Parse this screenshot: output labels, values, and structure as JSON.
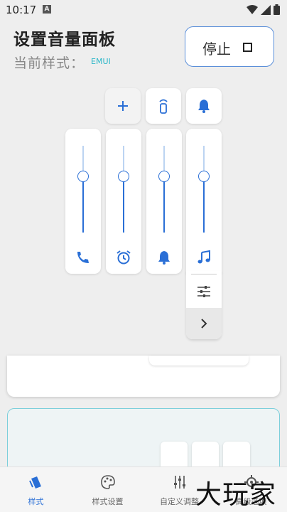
{
  "status_bar": {
    "time": "10:17",
    "notif_icon": "A"
  },
  "header": {
    "title": "设置音量面板",
    "style_label": "当前样式：",
    "style_value": "EMUI",
    "stop_button": {
      "label": "停止"
    }
  },
  "panel": {
    "top_buttons": [
      "plus-icon",
      "remote-icon",
      "bell-icon"
    ],
    "sliders": [
      {
        "name": "call",
        "icon": "phone-icon",
        "level": 0.65
      },
      {
        "name": "alarm",
        "icon": "alarm-icon",
        "level": 0.65
      },
      {
        "name": "notification",
        "icon": "bell-icon",
        "level": 0.65
      },
      {
        "name": "media",
        "icon": "music-icon",
        "level": 0.65
      }
    ]
  },
  "nav": {
    "items": [
      {
        "label": "样式",
        "icon": "style-icon",
        "active": true
      },
      {
        "label": "样式设置",
        "icon": "palette-icon",
        "active": false
      },
      {
        "label": "自定义调整",
        "icon": "tune-icon",
        "active": false
      },
      {
        "label": "高级选项",
        "icon": "gear-icon",
        "active": false
      }
    ]
  },
  "watermark": "大玩家",
  "colors": {
    "accent": "#2a6fd6",
    "cyan": "#29b6c8",
    "background": "#eeeeee"
  }
}
